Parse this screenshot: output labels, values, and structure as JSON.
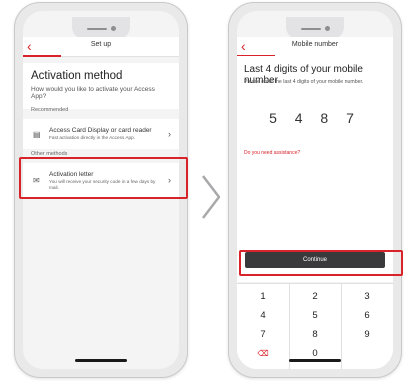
{
  "colors": {
    "accent": "#d8232a",
    "button_dark": "#3a3a3c"
  },
  "phone1": {
    "nav": {
      "back_icon": "chevron-left-icon",
      "title": "Set up"
    },
    "header": {
      "title": "Activation method",
      "subtitle": "How would you like to activate your Access App?"
    },
    "recommended_label": "Recommended",
    "option1": {
      "icon": "card-reader-icon",
      "title": "Access Card Display or card reader",
      "desc": "Fast activation directly in the Access App."
    },
    "other_label": "Other methods",
    "option2": {
      "icon": "envelope-icon",
      "title": "Activation letter",
      "desc": "You will receive your security code in a few days by mail."
    }
  },
  "phone2": {
    "nav": {
      "back_icon": "chevron-left-icon",
      "title": "Mobile number"
    },
    "title": "Last 4 digits of your mobile number",
    "subtitle": "Please enter the last 4 digits of your mobile number.",
    "digits": "5 4 8 7",
    "assistance_link": "Do you need assistance?",
    "continue_label": "Continue",
    "keypad": {
      "k1": "1",
      "k2": "2",
      "k3": "3",
      "k4": "4",
      "k5": "5",
      "k6": "6",
      "k7": "7",
      "k8": "8",
      "k9": "9",
      "k0": "0",
      "delete_icon": "backspace-icon"
    }
  }
}
